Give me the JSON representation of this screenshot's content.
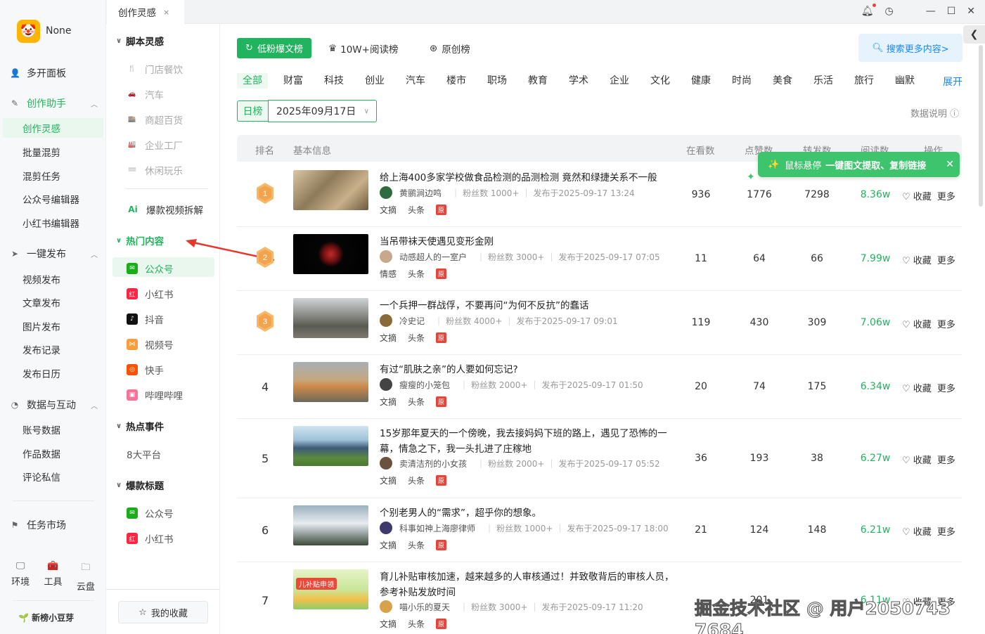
{
  "user": {
    "name": "None"
  },
  "leftnav": {
    "multi_panel": "多开面板",
    "creation_assistant": "创作助手",
    "creation_items": [
      "创作灵感",
      "批量混剪",
      "混剪任务",
      "公众号编辑器",
      "小红书编辑器"
    ],
    "publish": "一键发布",
    "publish_items": [
      "视频发布",
      "文章发布",
      "图片发布",
      "发布记录",
      "发布日历"
    ],
    "data": "数据与互动",
    "data_items": [
      "账号数据",
      "作品数据",
      "评论私信"
    ],
    "task_market": "任务市场",
    "tools": [
      "环境",
      "工具",
      "云盘"
    ],
    "brand": "新榜小豆芽"
  },
  "tab": {
    "label": "创作灵感",
    "close": "×"
  },
  "sidebar2": {
    "script_head": "脚本灵感",
    "script_items": [
      "门店餐饮",
      "汽车",
      "商超百货",
      "企业工厂",
      "休闲玩乐"
    ],
    "video_breakdown": "爆款视频拆解",
    "hot_head": "热门内容",
    "hot_items": [
      "公众号",
      "小红书",
      "抖音",
      "视频号",
      "快手",
      "哔哩哔哩"
    ],
    "events_head": "热点事件",
    "events_items": [
      "8大平台"
    ],
    "titles_head": "爆款标题",
    "titles_items": [
      "公众号",
      "小红书"
    ],
    "favorites": "我的收藏"
  },
  "main": {
    "rank_tabs": [
      "低粉爆文榜",
      "10W+阅读榜",
      "原创榜"
    ],
    "search_more": "搜索更多内容>",
    "categories": [
      "全部",
      "财富",
      "科技",
      "创业",
      "汽车",
      "楼市",
      "职场",
      "教育",
      "学术",
      "企业",
      "文化",
      "健康",
      "时尚",
      "美食",
      "乐活",
      "旅行",
      "幽默"
    ],
    "expand": "展开",
    "day_label": "日榜",
    "date": "2025年09月17日",
    "data_note": "数据说明",
    "headers": [
      "排名",
      "基本信息",
      "在看数",
      "点赞数",
      "转发数",
      "阅读数",
      "操作"
    ],
    "tooltip_a": "鼠标悬停",
    "tooltip_b": "一键图文提取、复制链接",
    "rows": [
      {
        "rank": "1",
        "title": "给上海400多家学校做食品检测的品测检测 竟然和绿捷关系不一般",
        "author": "黄鹂涧边鸣",
        "fans": "粉丝数 1000+",
        "published": "发布于2025-09-17 13:24",
        "tags": [
          "文摘",
          "头条"
        ],
        "watch": "936",
        "likes": "1776",
        "shares": "7298",
        "reads": "8.36w"
      },
      {
        "rank": "2",
        "title": "当吊带袜天使遇见变形金刚",
        "author": "动感超人的一室户",
        "fans": "粉丝数 3000+",
        "published": "发布于2025-09-17 07:05",
        "tags": [
          "情感",
          "头条"
        ],
        "watch": "11",
        "likes": "64",
        "shares": "66",
        "reads": "7.99w"
      },
      {
        "rank": "3",
        "title": "一个兵押一群战俘，不要再问“为何不反抗”的蠢话",
        "author": "冷史记",
        "fans": "粉丝数 4000+",
        "published": "发布于2025-09-17 09:01",
        "tags": [
          "文摘",
          "头条"
        ],
        "watch": "119",
        "likes": "430",
        "shares": "309",
        "reads": "7.06w"
      },
      {
        "rank": "4",
        "title": "有过“肌肤之亲”的人要如何忘记?",
        "author": "瘦瘦的小笼包",
        "fans": "粉丝数 2000+",
        "published": "发布于2025-09-17 01:50",
        "tags": [
          "文摘",
          "头条"
        ],
        "watch": "20",
        "likes": "74",
        "shares": "175",
        "reads": "6.34w"
      },
      {
        "rank": "5",
        "title": "15岁那年夏天的一个傍晚，我去接妈妈下班的路上，遇见了恐怖的一幕，情急之下，我一头扎进了庄稼地",
        "author": "卖清洁剂的小女孩",
        "fans": "粉丝数 2000+",
        "published": "发布于2025-09-17 05:52",
        "tags": [
          "文摘",
          "头条"
        ],
        "watch": "36",
        "likes": "193",
        "shares": "38",
        "reads": "6.27w"
      },
      {
        "rank": "6",
        "title": "个别老男人的“需求”，超乎你的想象。",
        "author": "科事如神上海廖律师",
        "fans": "粉丝数 1000+",
        "published": "发布于2025-09-17 18:00",
        "tags": [
          "文摘",
          "头条"
        ],
        "watch": "21",
        "likes": "124",
        "shares": "148",
        "reads": "6.21w"
      },
      {
        "rank": "7",
        "title": "育儿补贴审核加速，越来越多的人审核通过！并致敬背后的审核人员，参考补贴发放时间",
        "author": "喵小乐的夏天",
        "fans": "粉丝数 3000+",
        "published": "发布于2025-09-17 11:20",
        "tags": [
          "文摘",
          "头条"
        ],
        "watch": "",
        "likes": "201",
        "shares": "",
        "reads": "6.11w"
      }
    ],
    "row_actions": {
      "fav": "收藏",
      "more": "更多"
    },
    "thumb7_text": "儿补贴申领"
  },
  "watermark": "掘金技术社区 @ 用户2050743​7684",
  "colors": {
    "accent": "#22b35e",
    "link": "#1989fa",
    "tag_red": "#e6453a"
  }
}
